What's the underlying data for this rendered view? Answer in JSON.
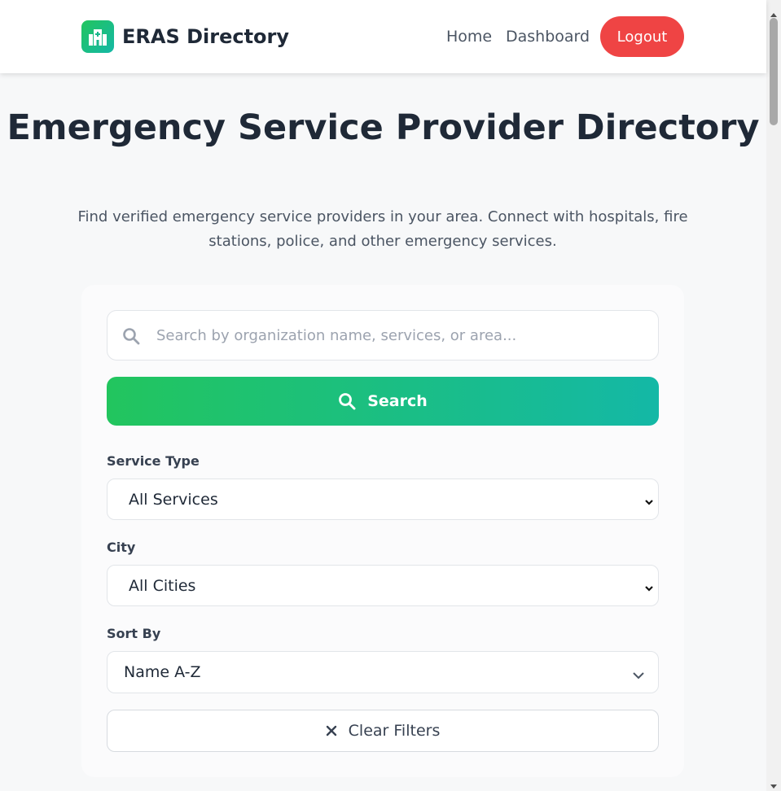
{
  "nav": {
    "brand": "ERAS Directory",
    "brand_icon": "hospital-icon",
    "links": [
      "Home",
      "Dashboard"
    ],
    "logout": "Logout"
  },
  "hero": {
    "title": "Emergency Service Provider Directory",
    "subtitle": "Find verified emergency service providers in your area. Connect with hospitals, fire stations, police, and other emergency services."
  },
  "search": {
    "placeholder": "Search by organization name, services, or area...",
    "button": "Search"
  },
  "filters": {
    "service_type": {
      "label": "Service Type",
      "value": "All Services"
    },
    "city": {
      "label": "City",
      "value": "All Cities"
    },
    "sort_by": {
      "label": "Sort By",
      "value": "Name A-Z"
    },
    "clear": "Clear Filters"
  },
  "colors": {
    "accent_start": "#22c55e",
    "accent_end": "#14b8a6",
    "logout": "#ef4444"
  }
}
